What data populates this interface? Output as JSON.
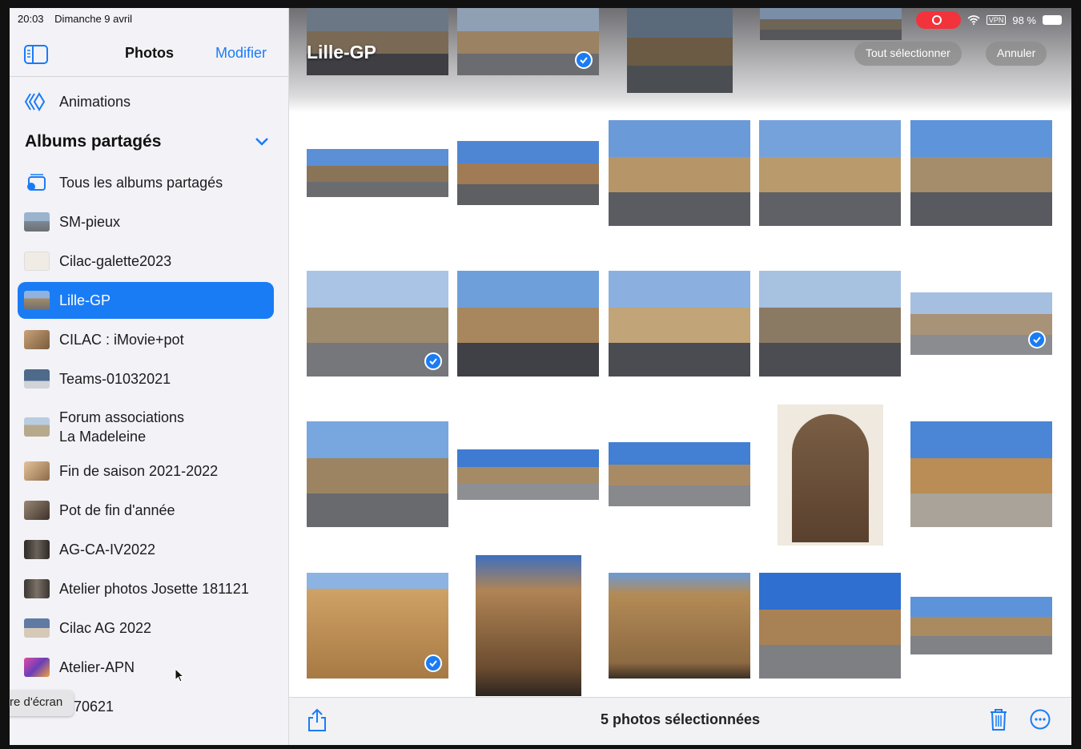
{
  "status": {
    "time": "20:03",
    "date": "Dimanche 9 avril",
    "battery": "98 %",
    "vpn": "VPN"
  },
  "sidebar": {
    "title": "Photos",
    "edit_label": "Modifier",
    "animations_label": "Animations",
    "section_title": "Albums partagés",
    "items": [
      {
        "label": "Tous les albums partagés",
        "color": "#1a7cf5"
      },
      {
        "label": "SM-pieux",
        "color": "#7e8a96"
      },
      {
        "label": "Cilac-galette2023",
        "color": "#e9e2d8"
      },
      {
        "label": "Lille-GP",
        "color": "#8d9eb3"
      },
      {
        "label": "CILAC : iMovie+pot",
        "color": "#9a7b5a"
      },
      {
        "label": "Teams-01032021",
        "color": "#4d6a8a"
      },
      {
        "label": "Forum associations",
        "label2": "La Madeleine",
        "color": "#b6a98c"
      },
      {
        "label": "Fin de saison 2021-2022",
        "color": "#c79a6e"
      },
      {
        "label": "Pot de fin d'année",
        "color": "#6b5a4a"
      },
      {
        "label": "AG-CA-IV2022",
        "color": "#3d3a37"
      },
      {
        "label": "Atelier photos Josette 181121",
        "color": "#4b4540"
      },
      {
        "label": "Cilac AG 2022",
        "color": "#5f7aa3"
      },
      {
        "label": "Atelier-APN",
        "color": "#c9479a"
      },
      {
        "label": "70621",
        "color": "#5b5b5b"
      }
    ],
    "tooltip": "re d'écran"
  },
  "main": {
    "album_title": "Lille-GP",
    "select_all_label": "Tout sélectionner",
    "cancel_label": "Annuler",
    "selection_count": "5 photos sélectionnées"
  },
  "colors": {
    "accent": "#1a7cf5",
    "sky": "#5b8fd6",
    "building": "#b69568",
    "ground": "#6b6c70"
  }
}
